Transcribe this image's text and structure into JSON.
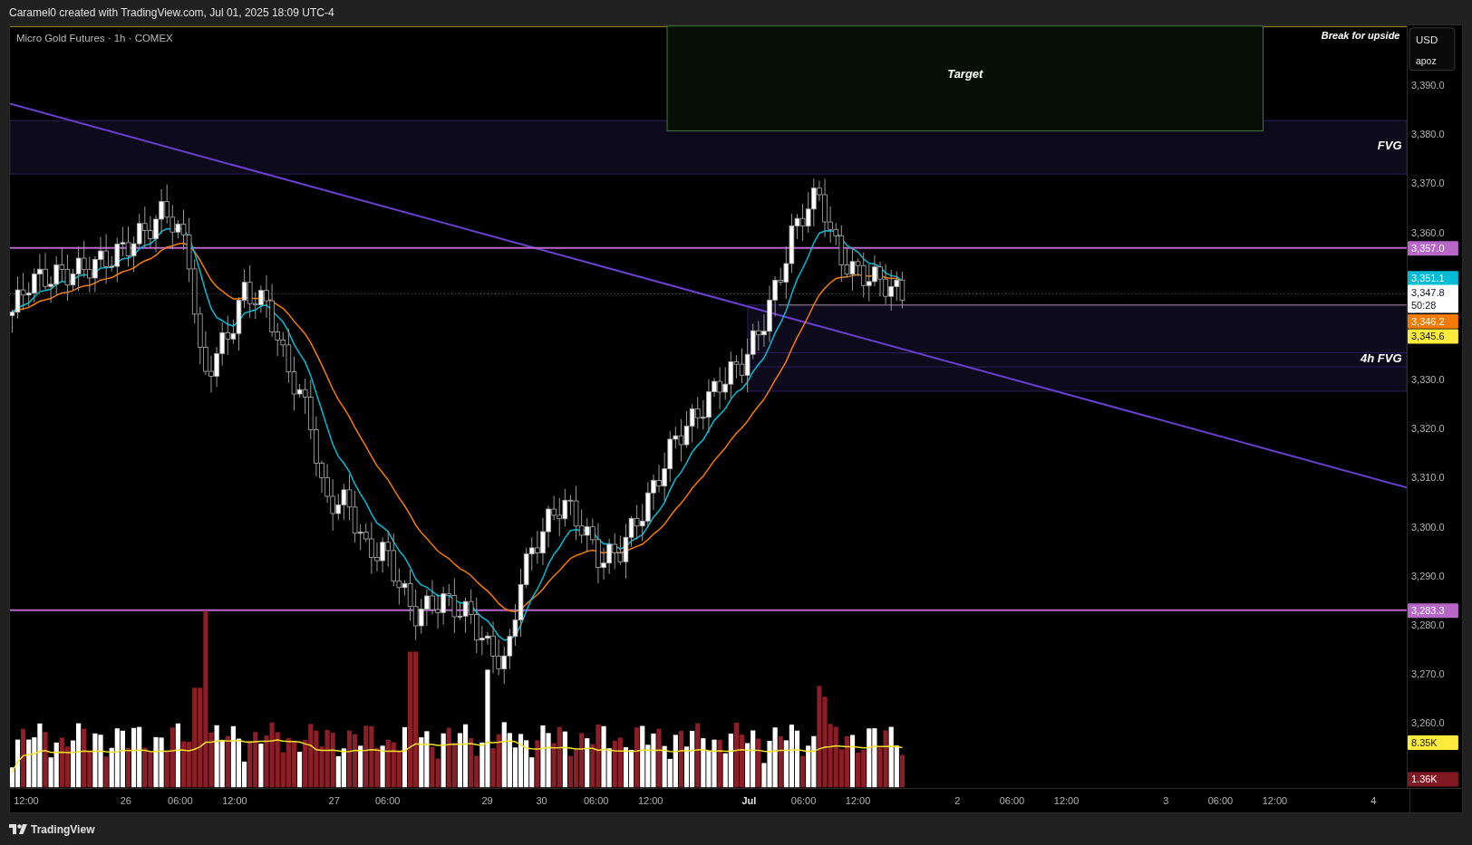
{
  "header": {
    "text": "Caramel0 created with TradingView.com, Jul 01, 2025 18:09 UTC-4"
  },
  "chart": {
    "legend": "Micro Gold Futures · 1h · COMEX",
    "annotations": [
      {
        "kind": "target",
        "text": "Target"
      },
      {
        "kind": "note",
        "text": "Break for upside"
      },
      {
        "kind": "zone",
        "text": "FVG"
      },
      {
        "kind": "zone",
        "text": "4h FVG"
      }
    ]
  },
  "price_axis": {
    "currency": "USD",
    "unit": "apoz",
    "ticks": [
      "3,390.0",
      "3,380.0",
      "3,370.0",
      "3,360.0",
      "3,330.0",
      "3,320.0",
      "3,310.0",
      "3,300.0",
      "3,290.0",
      "3,280.0",
      "3,270.0",
      "3,260.0"
    ],
    "tags": [
      {
        "lines": [
          "3,357.0"
        ],
        "color": "#b667c8"
      },
      {
        "lines": [
          "3,351.1"
        ],
        "color": "#00bcd4"
      },
      {
        "lines": [
          "3,347.8",
          "50:28"
        ],
        "color": "#ffffff"
      },
      {
        "lines": [
          "3,346.2"
        ],
        "color": "#f57c00"
      },
      {
        "lines": [
          "3,345.6"
        ],
        "color": "#ffeb3b"
      },
      {
        "lines": [
          "3,283.3"
        ],
        "color": "#b667c8"
      },
      {
        "lines": [
          "8.35K"
        ],
        "color": "#ffeb3b"
      },
      {
        "lines": [
          "1.36K"
        ],
        "color": "#801922"
      }
    ]
  },
  "time_axis": {
    "labels": [
      {
        "text": "12:00",
        "kind": "time"
      },
      {
        "text": "26",
        "kind": "day"
      },
      {
        "text": "06:00",
        "kind": "time"
      },
      {
        "text": "12:00",
        "kind": "time"
      },
      {
        "text": "27",
        "kind": "day"
      },
      {
        "text": "06:00",
        "kind": "time"
      },
      {
        "text": "29",
        "kind": "day"
      },
      {
        "text": "30",
        "kind": "day"
      },
      {
        "text": "06:00",
        "kind": "time"
      },
      {
        "text": "12:00",
        "kind": "time"
      },
      {
        "text": "Jul",
        "kind": "month"
      },
      {
        "text": "06:00",
        "kind": "time"
      },
      {
        "text": "12:00",
        "kind": "time"
      },
      {
        "text": "2",
        "kind": "day"
      },
      {
        "text": "06:00",
        "kind": "time"
      },
      {
        "text": "12:00",
        "kind": "time"
      },
      {
        "text": "3",
        "kind": "day"
      },
      {
        "text": "06:00",
        "kind": "time"
      },
      {
        "text": "12:00",
        "kind": "time"
      },
      {
        "text": "4",
        "kind": "day"
      }
    ]
  },
  "footer": {
    "brand": "TradingView"
  }
}
